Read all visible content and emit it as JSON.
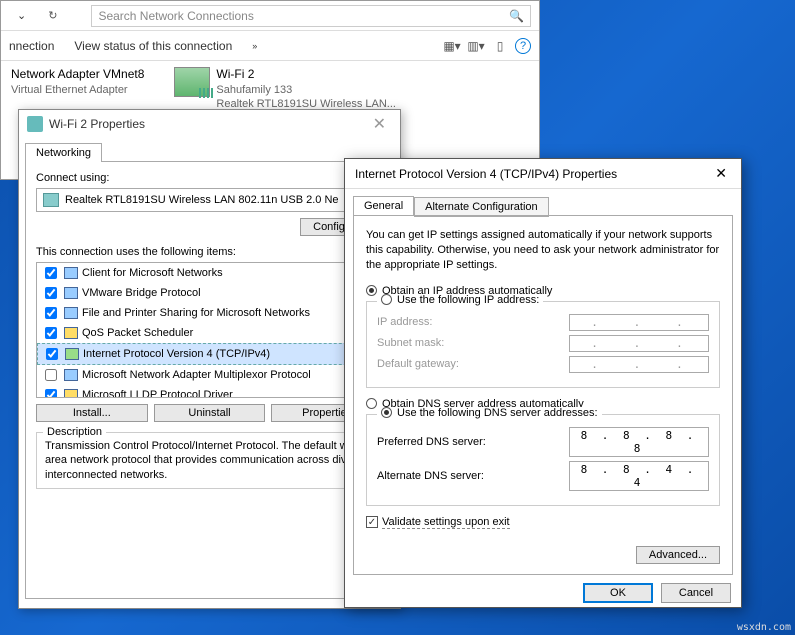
{
  "explorer": {
    "search_placeholder": "Search Network Connections",
    "cmd1": "nnection",
    "cmd2": "View status of this connection",
    "item1_name": "Network Adapter VMnet8",
    "item1_sub": "Virtual Ethernet Adapter",
    "item2_name": "Wi-Fi 2",
    "item2_sub1": "Sahufamily  133",
    "item2_sub2": "Realtek RTL8191SU Wireless LAN..."
  },
  "wifi": {
    "title": "Wi-Fi 2 Properties",
    "tab": "Networking",
    "connect_label": "Connect using:",
    "adapter": "Realtek RTL8191SU Wireless LAN 802.11n USB 2.0 Ne",
    "configure": "Configure...",
    "items_label": "This connection uses the following items:",
    "items": [
      {
        "c": true,
        "t": "Client for Microsoft Networks"
      },
      {
        "c": true,
        "t": "VMware Bridge Protocol"
      },
      {
        "c": true,
        "t": "File and Printer Sharing for Microsoft Networks"
      },
      {
        "c": true,
        "t": "QoS Packet Scheduler"
      },
      {
        "c": true,
        "t": "Internet Protocol Version 4 (TCP/IPv4)",
        "sel": true
      },
      {
        "c": false,
        "t": "Microsoft Network Adapter Multiplexor Protocol"
      },
      {
        "c": true,
        "t": "Microsoft LLDP Protocol Driver"
      }
    ],
    "install": "Install...",
    "uninstall": "Uninstall",
    "properties": "Properties",
    "desc_title": "Description",
    "desc": "Transmission Control Protocol/Internet Protocol. The default wide area network protocol that provides communication across diverse interconnected networks."
  },
  "ipv4": {
    "title": "Internet Protocol Version 4 (TCP/IPv4) Properties",
    "tab1": "General",
    "tab2": "Alternate Configuration",
    "info": "You can get IP settings assigned automatically if your network supports this capability. Otherwise, you need to ask your network administrator for the appropriate IP settings.",
    "r1": "Obtain an IP address automatically",
    "r2": "Use the following IP address:",
    "f_ip": "IP address:",
    "f_mask": "Subnet mask:",
    "f_gw": "Default gateway:",
    "r3": "Obtain DNS server address automatically",
    "r4": "Use the following DNS server addresses:",
    "f_dns1": "Preferred DNS server:",
    "f_dns2": "Alternate DNS server:",
    "dns1": "8 . 8 . 8 . 8",
    "dns2": "8 . 8 . 4 . 4",
    "validate": "Validate settings upon exit",
    "advanced": "Advanced...",
    "ok": "OK",
    "cancel": "Cancel"
  },
  "watermark": "wsxdn.com"
}
